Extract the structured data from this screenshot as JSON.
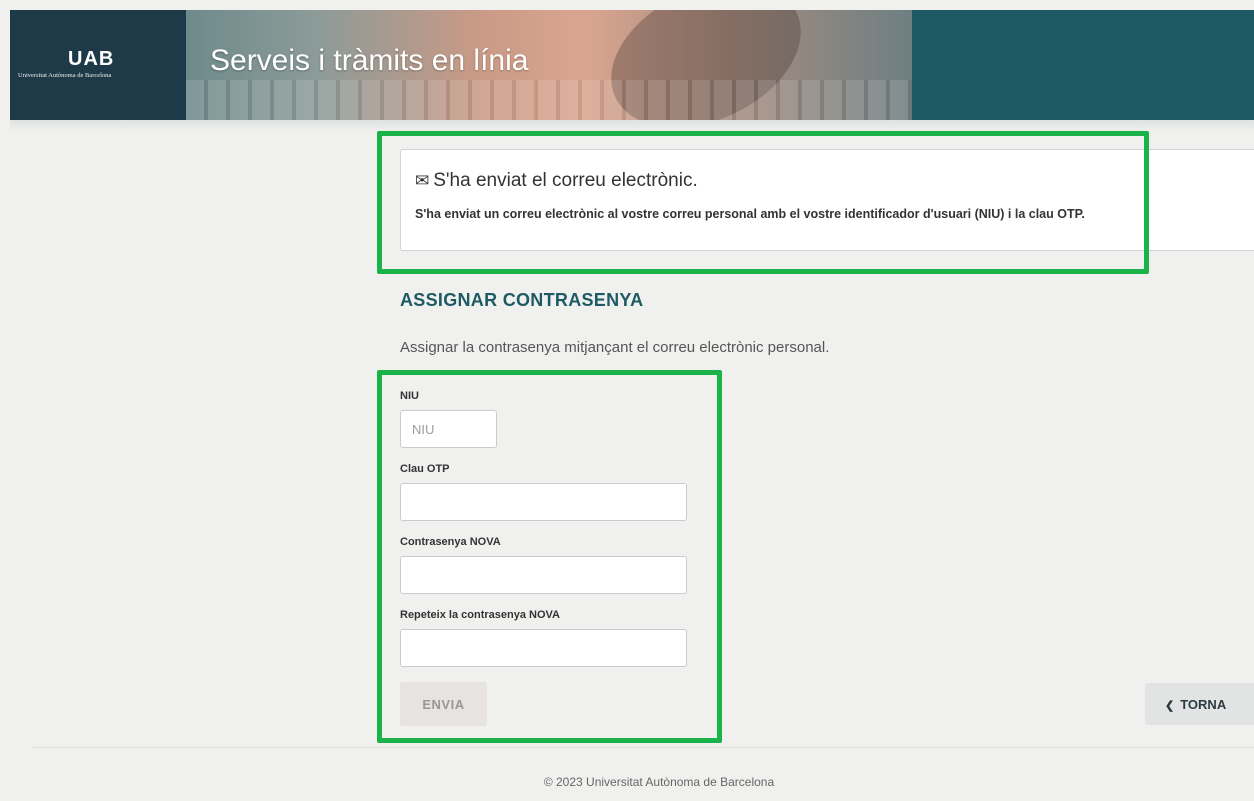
{
  "header": {
    "logo_mark": "UAB",
    "logo_subtitle": "Universitat Autònoma de Barcelona",
    "title": "Serveis i tràmits en línia"
  },
  "alert": {
    "icon": "envelope-icon",
    "title": "S'ha enviat el correu electrònic.",
    "message": "S'ha enviat un correu electrònic al vostre correu personal amb el vostre identificador d'usuari (NIU) i la clau OTP."
  },
  "section": {
    "title": "ASSIGNAR CONTRASENYA",
    "description": "Assignar la contrasenya mitjançant el correu electrònic personal."
  },
  "form": {
    "niu": {
      "label": "NIU",
      "placeholder": "NIU",
      "value": ""
    },
    "otp": {
      "label": "Clau OTP",
      "placeholder": "",
      "value": ""
    },
    "new_password": {
      "label": "Contrasenya NOVA",
      "placeholder": "",
      "value": ""
    },
    "repeat_password": {
      "label": "Repeteix la contrasenya NOVA",
      "placeholder": "",
      "value": ""
    },
    "submit_label": "ENVIA"
  },
  "back_button": {
    "icon": "chevron-left-icon",
    "glyph": "❮",
    "label": "TORNA"
  },
  "footer": {
    "text": "© 2023 Universitat Autònoma de Barcelona"
  },
  "colors": {
    "header": "#1e5a63",
    "logo_block": "#1e3a48",
    "highlight": "#19b34a",
    "section_title": "#1e5a63"
  }
}
